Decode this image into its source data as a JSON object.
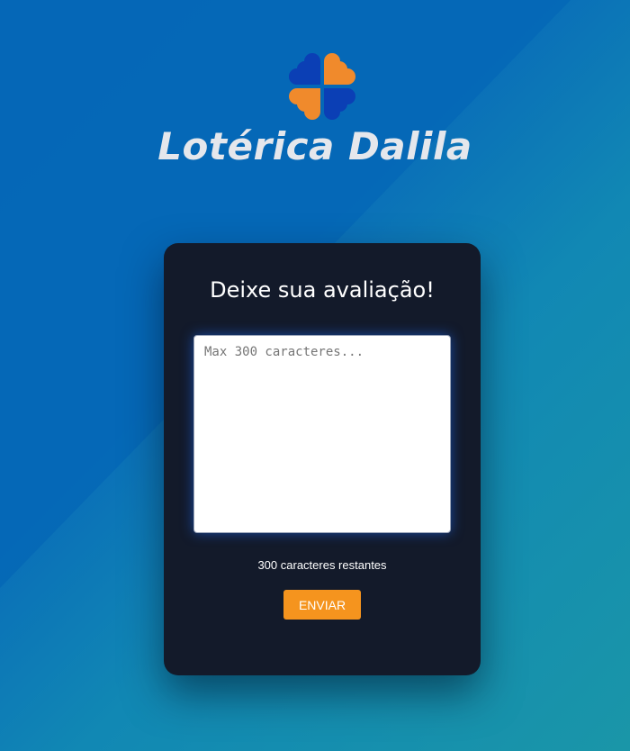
{
  "brand": {
    "name": "Lotérica Dalila",
    "logo_icon": "four-leaf-clover-hearts-icon",
    "colors": {
      "orange": "#f08a2c",
      "blue": "#0b3fb5"
    }
  },
  "review_form": {
    "title": "Deixe sua avaliação!",
    "textarea": {
      "value": "",
      "placeholder": "Max 300 caracteres..."
    },
    "counter_text": "300 caracteres restantes",
    "submit_label": "ENVIAR"
  },
  "theme": {
    "card_background": "#131a2a",
    "accent": "#f5941e"
  }
}
